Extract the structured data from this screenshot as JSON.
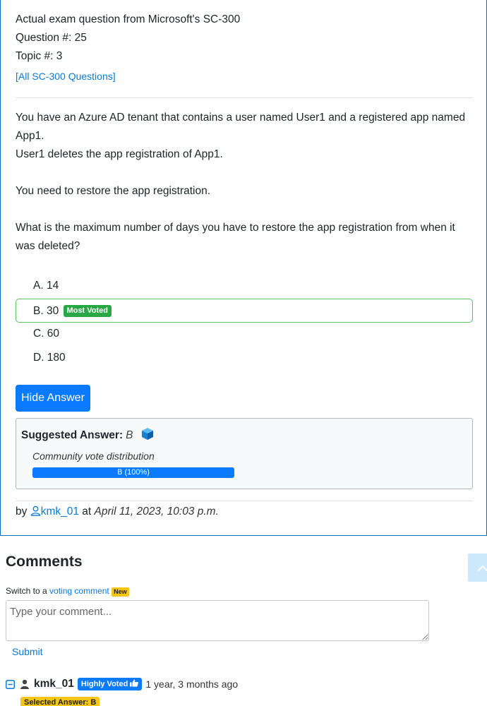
{
  "question": {
    "source_line": "Actual exam question from Microsoft's SC-300",
    "number_line": "Question #: 25",
    "topic_line": "Topic #: 3",
    "all_questions_link": "[All SC-300 Questions]",
    "paragraphs": [
      "You have an Azure AD tenant that contains a user named User1 and a registered app named App1.",
      "User1 deletes the app registration of App1.",
      "You need to restore the app registration.",
      "What is the maximum number of days you have to restore the app registration from when it was deleted?"
    ],
    "choices": [
      {
        "label": "A. 14"
      },
      {
        "label": "B. 30",
        "badge": "Most Voted"
      },
      {
        "label": "C. 60"
      },
      {
        "label": "D. 180"
      }
    ],
    "hide_answer_button": "Hide Answer",
    "suggested_answer_label": "Suggested Answer:",
    "suggested_answer": "B",
    "vote_distribution_label": "Community vote distribution",
    "vote_bar_text": "B (100%)",
    "vote_fraction": 1.0,
    "byline_prefix": "by",
    "author": "kmk_01",
    "byline_at": "at",
    "posted_date": "April 11, 2023, 10:03 p.m."
  },
  "comments": {
    "title": "Comments",
    "switch_text": "Switch to a",
    "voting_link": "voting comment",
    "new_badge": "New",
    "input_placeholder": "Type your comment...",
    "submit_label": "Submit",
    "items": [
      {
        "user": "kmk_01",
        "badge": "Highly Voted",
        "time": "1 year, 3 months ago",
        "selected_answer": "Selected Answer: B"
      }
    ]
  },
  "colors": {
    "accent": "#0a7bff",
    "most_voted": "#28a745",
    "highlight_badge": "#f5c518"
  }
}
